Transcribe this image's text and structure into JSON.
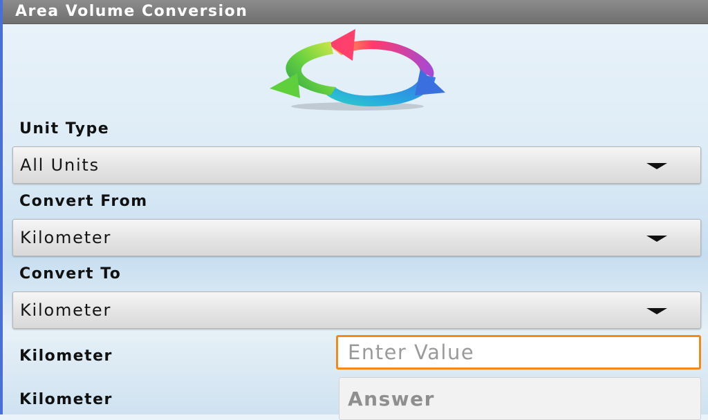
{
  "window": {
    "title": "Area Volume Conversion"
  },
  "logo": {
    "icon": "circular-arrows-refresh-icon",
    "colors": [
      "#e83a72",
      "#3a7fe0",
      "#28c6c0",
      "#6ad23f",
      "#9b3ad6"
    ]
  },
  "form": {
    "unit_type_label": "Unit Type",
    "unit_type_value": "All Units",
    "convert_from_label": "Convert From",
    "convert_from_value": "Kilometer",
    "convert_to_label": "Convert To",
    "convert_to_value": "Kilometer",
    "input_unit_label": "Kilometer",
    "input_placeholder": "Enter Value",
    "output_unit_label": "Kilometer",
    "answer_text": "Answer"
  },
  "colors": {
    "focus_border": "#f08a1a",
    "titlebar": "#7a7a7a"
  }
}
